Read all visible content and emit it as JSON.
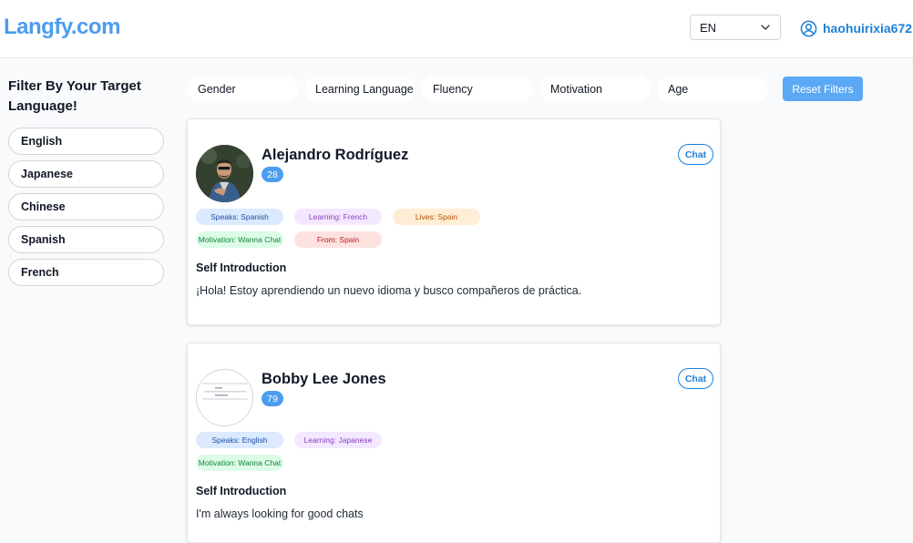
{
  "header": {
    "logo": "Langfy.com",
    "language_select": "EN",
    "username": "haohuirixia672"
  },
  "sidebar": {
    "title": "Filter By Your Target Language!",
    "items": [
      {
        "label": "English"
      },
      {
        "label": "Japanese"
      },
      {
        "label": "Chinese"
      },
      {
        "label": "Spanish"
      },
      {
        "label": "French"
      }
    ]
  },
  "filters": {
    "pills": [
      {
        "label": "Gender"
      },
      {
        "label": "Learning Language"
      },
      {
        "label": "Fluency"
      },
      {
        "label": "Motivation"
      },
      {
        "label": "Age"
      }
    ],
    "reset_label": "Reset Filters"
  },
  "profiles": [
    {
      "name": "Alejandro Rodríguez",
      "age": "28",
      "chat_label": "Chat",
      "tags": {
        "speaks": "Speaks: Spanish",
        "learning": "Learning: French",
        "lives": "Lives: Spain",
        "motivation": "Motivation: Wanna Chat",
        "from": "From: Spain"
      },
      "intro_title": "Self Introduction",
      "intro_text": "¡Hola! Estoy aprendiendo un nuevo idioma y busco compañeros de práctica."
    },
    {
      "name": "Bobby Lee Jones",
      "age": "79",
      "chat_label": "Chat",
      "tags": {
        "speaks": "Speaks: English",
        "learning": "Learning: Japanese",
        "motivation": "Motivation: Wanna Chat"
      },
      "intro_title": "Self Introduction",
      "intro_text": "I'm always looking for good chats"
    }
  ],
  "colors": {
    "brand": "#4b9df0",
    "link": "#1d7fd6",
    "reset_button": "#5ba8f5"
  },
  "icons": [
    "chevron-down-icon",
    "user-circle-icon"
  ]
}
